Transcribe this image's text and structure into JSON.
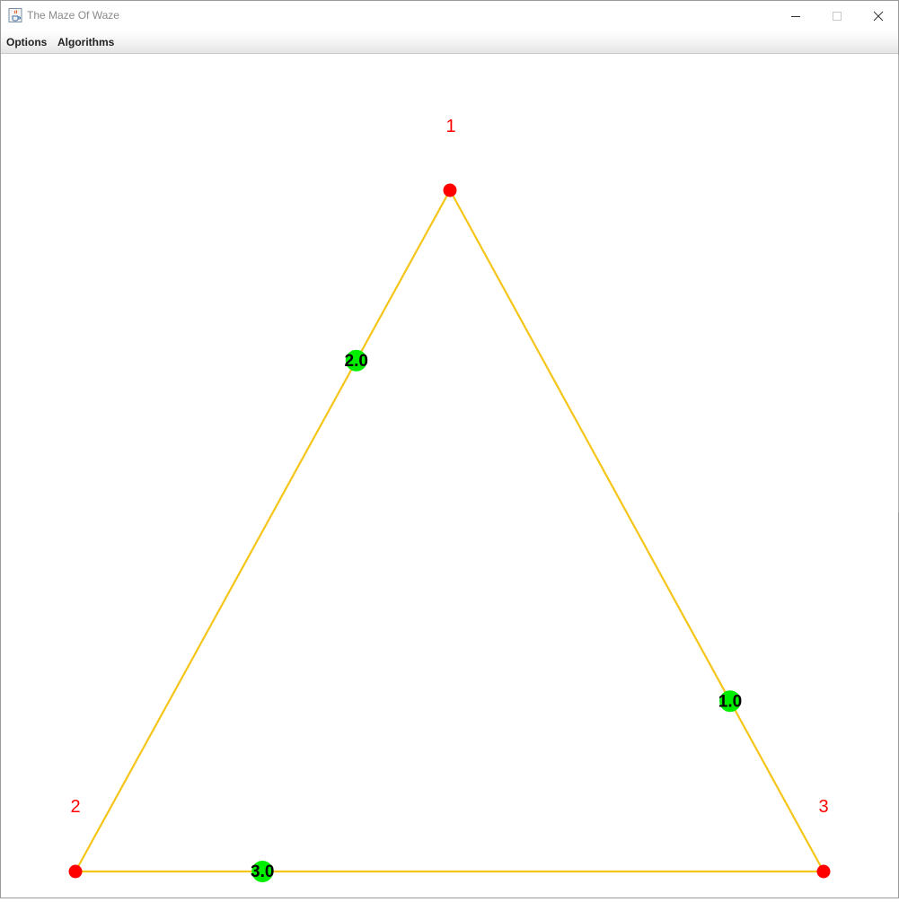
{
  "window": {
    "title": "The Maze Of Waze",
    "icon": "java-icon",
    "controls": [
      "minimize-icon",
      "maximize-icon",
      "close-icon"
    ]
  },
  "menubar": {
    "options_label": "Options",
    "algorithms_label": "Algorithms"
  },
  "graph": {
    "colors": {
      "node": "#ff0000",
      "node_label": "#ff0000",
      "edge": "#f5c518",
      "weight_marker": "#00ee00",
      "weight_text": "#000000"
    },
    "nodes": [
      {
        "id": "1",
        "label": "1"
      },
      {
        "id": "2",
        "label": "2"
      },
      {
        "id": "3",
        "label": "3"
      }
    ],
    "edges": [
      {
        "from": "1",
        "to": "3",
        "weight": "1.0"
      },
      {
        "from": "2",
        "to": "1",
        "weight": "2.0"
      },
      {
        "from": "3",
        "to": "2",
        "weight": "3.0"
      }
    ]
  }
}
